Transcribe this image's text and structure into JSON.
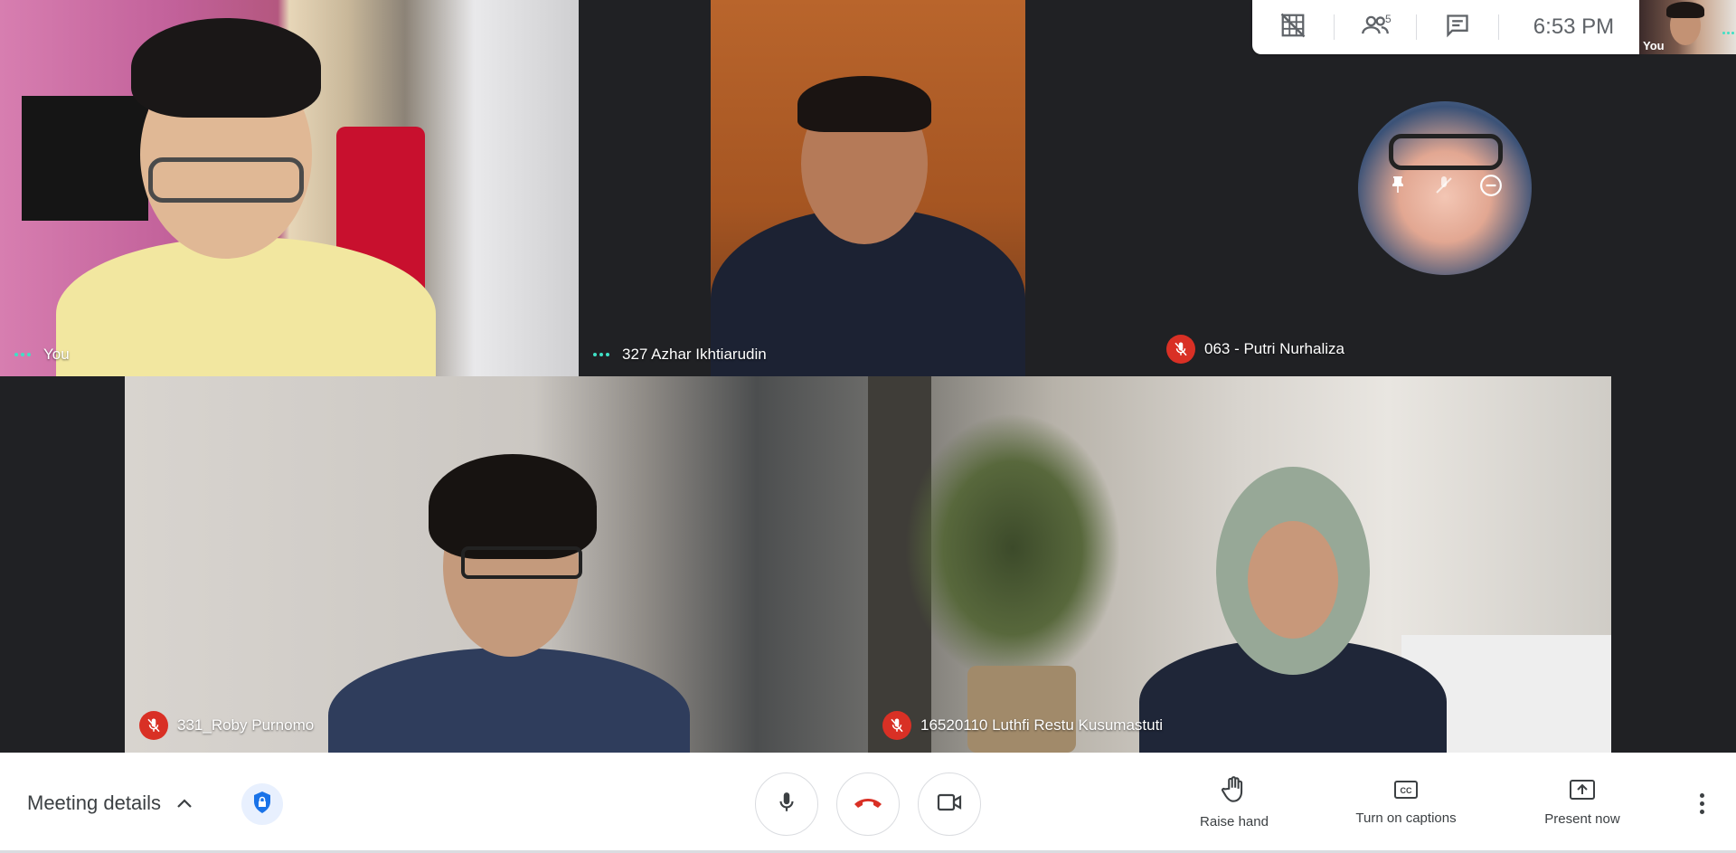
{
  "top_bar": {
    "participants_count": "5",
    "time": "6:53  PM",
    "self_view_label": "You",
    "icons": [
      "grid-off-icon",
      "people-icon",
      "chat-icon"
    ]
  },
  "tiles": {
    "you": {
      "name": "You"
    },
    "azhar": {
      "name": "327 Azhar Ikhtiarudin"
    },
    "putri": {
      "name": "063 - Putri Nurhaliza"
    },
    "roby": {
      "name": "331_Roby Purnomo"
    },
    "luthfi": {
      "name": "16520110 Luthfi Restu Kusumastuti"
    }
  },
  "bottom_bar": {
    "meeting_details_label": "Meeting details",
    "raise_hand_label": "Raise hand",
    "captions_label": "Turn on captions",
    "present_label": "Present now"
  },
  "colors": {
    "speaking_dots": "#3fe0c5",
    "mute_badge": "#d93025",
    "hangup_icon": "#d93025",
    "shield_icon": "#1a73e8"
  }
}
